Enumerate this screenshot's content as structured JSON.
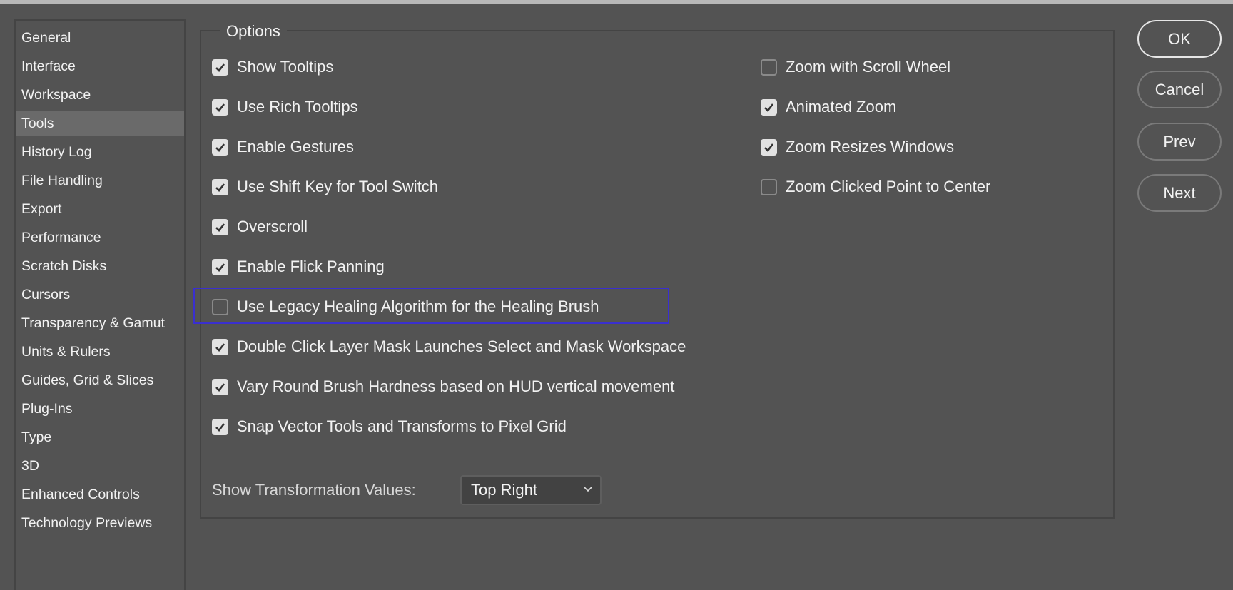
{
  "sidebar": {
    "selected": "Tools",
    "items": [
      "General",
      "Interface",
      "Workspace",
      "Tools",
      "History Log",
      "File Handling",
      "Export",
      "Performance",
      "Scratch Disks",
      "Cursors",
      "Transparency & Gamut",
      "Units & Rulers",
      "Guides, Grid & Slices",
      "Plug-Ins",
      "Type",
      "3D",
      "Enhanced Controls",
      "Technology Previews"
    ]
  },
  "options": {
    "title": "Options",
    "left": [
      {
        "label": "Show Tooltips",
        "checked": true
      },
      {
        "label": "Use Rich Tooltips",
        "checked": true
      },
      {
        "label": "Enable Gestures",
        "checked": true
      },
      {
        "label": "Use Shift Key for Tool Switch",
        "checked": true
      },
      {
        "label": "Overscroll",
        "checked": true
      },
      {
        "label": "Enable Flick Panning",
        "checked": true
      },
      {
        "label": "Use Legacy Healing Algorithm for the Healing Brush",
        "checked": false,
        "highlighted": true
      },
      {
        "label": "Double Click Layer Mask Launches Select and Mask Workspace",
        "checked": true
      },
      {
        "label": "Vary Round Brush Hardness based on HUD vertical movement",
        "checked": true
      },
      {
        "label": "Snap Vector Tools and Transforms to Pixel Grid",
        "checked": true
      }
    ],
    "right": [
      {
        "label": "Zoom with Scroll Wheel",
        "checked": false
      },
      {
        "label": "Animated Zoom",
        "checked": true
      },
      {
        "label": "Zoom Resizes Windows",
        "checked": true
      },
      {
        "label": "Zoom Clicked Point to Center",
        "checked": false
      }
    ],
    "transform": {
      "label": "Show Transformation Values:",
      "value": "Top Right"
    }
  },
  "buttons": {
    "ok": "OK",
    "cancel": "Cancel",
    "prev": "Prev",
    "next": "Next"
  },
  "colors": {
    "background": "#535353",
    "highlight_border": "#3a2fd0",
    "selected_item": "#6a6a6a"
  }
}
